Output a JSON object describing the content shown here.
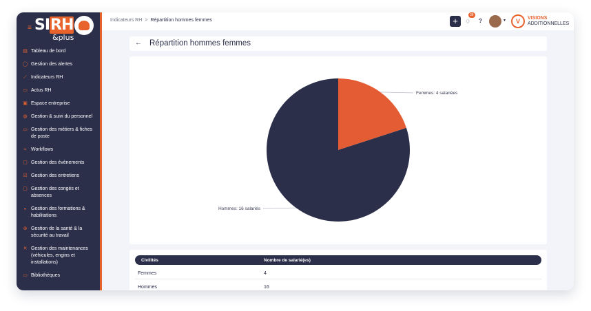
{
  "logo": {
    "text_s": "S",
    "text_i": "I",
    "text_hr": "RH",
    "plus": "&plus"
  },
  "sidebar": {
    "items": [
      {
        "label": "Tableau de bord",
        "icon": "dashboard-icon"
      },
      {
        "label": "Gestion des alertes",
        "icon": "bell-icon"
      },
      {
        "label": "Indicateurs RH",
        "icon": "chart-line-icon"
      },
      {
        "label": "Actus RH",
        "icon": "news-icon"
      },
      {
        "label": "Espace entreprise",
        "icon": "building-icon"
      },
      {
        "label": "Gestion & suivi du personnel",
        "icon": "users-icon"
      },
      {
        "label": "Gestion des métiers & fiches de poste",
        "icon": "briefcase-icon"
      },
      {
        "label": "Workflows",
        "icon": "workflow-icon"
      },
      {
        "label": "Gestion des évènements",
        "icon": "calendar-icon"
      },
      {
        "label": "Gestion des entretiens",
        "icon": "checklist-icon"
      },
      {
        "label": "Gestion des congés et absences",
        "icon": "calendar-off-icon"
      },
      {
        "label": "Gestion des formations & habilitations",
        "icon": "graduation-icon"
      },
      {
        "label": "Gestion de la santé & la sécurité au travail",
        "icon": "health-icon"
      },
      {
        "label": "Gestion des maintenances (véhicules, engins et installations)",
        "icon": "tools-icon"
      },
      {
        "label": "Bibliothèques",
        "icon": "folder-icon"
      }
    ]
  },
  "topbar": {
    "breadcrumb_parent": "Indicateurs RH",
    "breadcrumb_sep": ">",
    "breadcrumb_current": "Répartition hommes femmes",
    "plus_label": "+",
    "notif_count": "36",
    "help_label": "?",
    "brand_line1": "VISIONS",
    "brand_line2": "ADDITIONNELLES"
  },
  "page": {
    "back_label": "←",
    "title": "Répartition hommes femmes"
  },
  "chart_data": {
    "type": "pie",
    "slices": [
      {
        "label": "Femmes: 4 salariées",
        "value": 4,
        "color": "#e45c34"
      },
      {
        "label": "Hommes: 16 salariés",
        "value": 16,
        "color": "#2c2f4a"
      }
    ]
  },
  "table": {
    "columns": [
      "Civilités",
      "Nombre de salarié(es)"
    ],
    "rows": [
      [
        "Femmes",
        "4"
      ],
      [
        "Hommes",
        "16"
      ]
    ]
  },
  "colors": {
    "accent": "#e8622c",
    "navy": "#2c2f4a"
  }
}
